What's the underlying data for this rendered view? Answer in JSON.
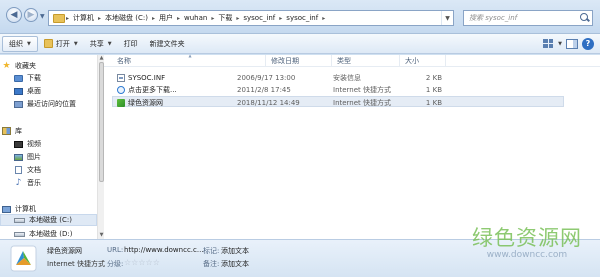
{
  "address_bar": {
    "breadcrumbs": [
      "计算机",
      "本地磁盘 (C:)",
      "用户",
      "wuhan",
      "下载",
      "sysoc_inf",
      "sysoc_inf"
    ]
  },
  "search": {
    "placeholder": "搜索 sysoc_inf"
  },
  "toolbar": {
    "organize": "组织",
    "open": "打开",
    "share": "共享",
    "print": "打印",
    "new_folder": "新建文件夹"
  },
  "sidebar": {
    "favorites_header": "收藏夹",
    "favorites": [
      "下载",
      "桌面",
      "最近访问的位置"
    ],
    "libraries_header": "库",
    "libraries": [
      "视频",
      "图片",
      "文档",
      "音乐"
    ],
    "computer_header": "计算机",
    "drives": [
      "本地磁盘 (C:)",
      "本地磁盘 (D:)"
    ]
  },
  "columns": {
    "name": "名称",
    "modified": "修改日期",
    "type": "类型",
    "size": "大小"
  },
  "files": [
    {
      "name": "SYSOC.INF",
      "modified": "2006/9/17 13:00",
      "type": "安装信息",
      "size": "2 KB"
    },
    {
      "name": "点击更多下载...",
      "modified": "2011/2/8 17:45",
      "type": "Internet 快捷方式",
      "size": "1 KB"
    },
    {
      "name": "绿色资源网",
      "modified": "2018/11/12 14:49",
      "type": "Internet 快捷方式",
      "size": "1 KB"
    }
  ],
  "details": {
    "name": "绿色资源网",
    "type": "Internet 快捷方式",
    "url_label": "URL:",
    "url_value": "http://www.downcc.c...",
    "rating_label": "分级:",
    "rating_stars": "☆☆☆☆☆",
    "rating_value": 0,
    "tags_label_1": "标记:",
    "tags_value_1": "添加文本",
    "tags_label_2": "备注:",
    "tags_value_2": "添加文本"
  },
  "watermark": {
    "title": "绿色资源网",
    "url": "www.downcc.com"
  }
}
